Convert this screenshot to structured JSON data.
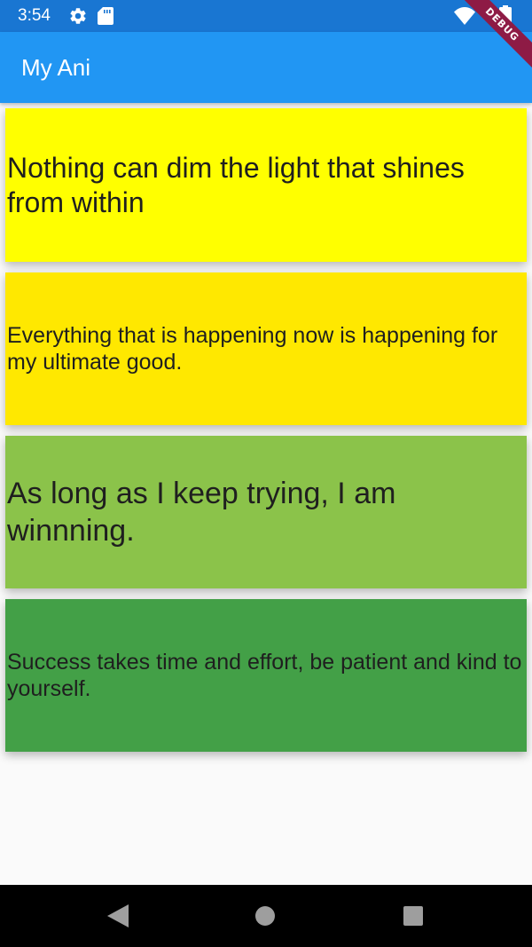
{
  "status_bar": {
    "time": "3:54",
    "background": "#1976d2"
  },
  "debug_banner": {
    "label": "DEBUG"
  },
  "app_bar": {
    "title": "My Ani",
    "color": "#2196f3"
  },
  "cards": [
    {
      "text": "Nothing can dim the light that shines from within",
      "color": "#ffff00"
    },
    {
      "text": "Everything that is happening now is happening for my ultimate good.",
      "color": "#ffe800"
    },
    {
      "text": "As long as I keep trying, I am winnning.",
      "color": "#8bc34a"
    },
    {
      "text": "Success takes time and effort, be patient and kind to yourself.",
      "color": "#43a047"
    }
  ],
  "icons": {
    "status": [
      "gear-icon",
      "sd-card-icon",
      "wifi-icon",
      "battery-icon"
    ],
    "nav": [
      "back-icon",
      "home-icon",
      "recents-icon"
    ]
  }
}
